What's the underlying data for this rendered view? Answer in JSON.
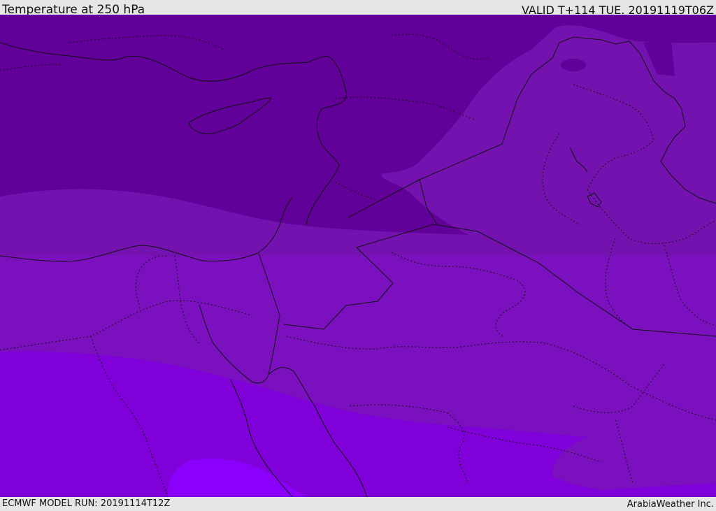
{
  "header": {
    "title": "Temperature at 250 hPa",
    "valid": "VALID T+114 TUE. 20191119T06Z"
  },
  "footer": {
    "model_run": "ECMWF MODEL RUN: 20191114T12Z",
    "credit": "ArabiaWeather Inc."
  },
  "map": {
    "fill_colors": {
      "coldest": "#62009a",
      "cold": "#7412b0",
      "cool": "#7a10be",
      "mild": "#7f00d8",
      "warm": "#8a00fa"
    },
    "border_color": "#111111",
    "internal_border_style": "dotted"
  }
}
